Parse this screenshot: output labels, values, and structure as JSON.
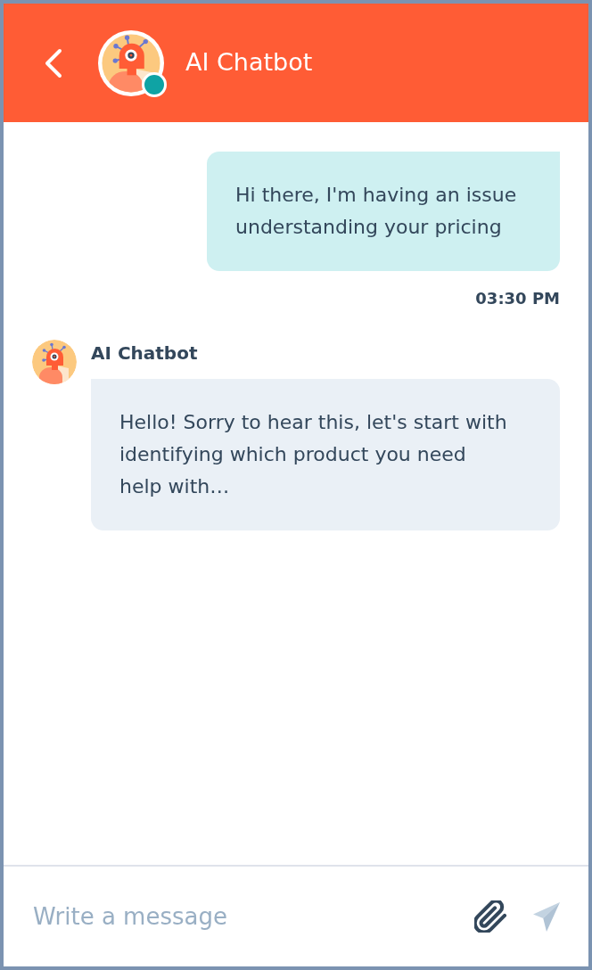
{
  "header": {
    "title": "AI Chatbot",
    "online": true
  },
  "messages": [
    {
      "kind": "user",
      "text": "Hi there, I'm having an issue understanding your pricing",
      "time": "03:30 PM"
    },
    {
      "kind": "bot",
      "sender": "AI Chatbot",
      "text": "Hello! Sorry to hear this, let's start with identifying which product you need help with…"
    }
  ],
  "composer": {
    "placeholder": "Write a message",
    "send": {
      "disabled": true
    }
  }
}
